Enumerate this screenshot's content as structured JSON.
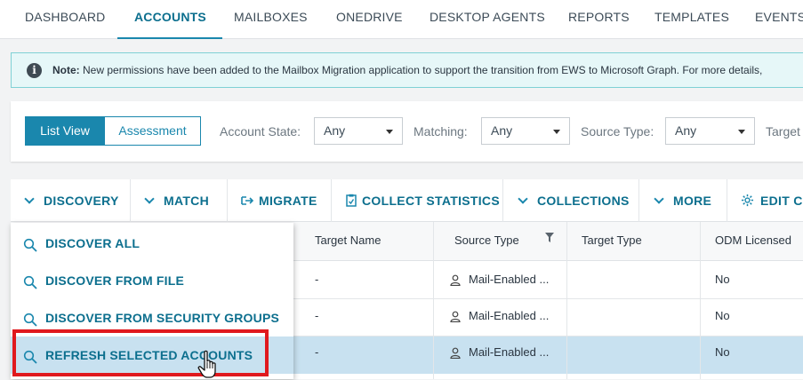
{
  "nav": {
    "tabs": [
      {
        "label": "DASHBOARD",
        "active": false
      },
      {
        "label": "ACCOUNTS",
        "active": true
      },
      {
        "label": "MAILBOXES",
        "active": false
      },
      {
        "label": "ONEDRIVE",
        "active": false
      },
      {
        "label": "DESKTOP AGENTS",
        "active": false
      },
      {
        "label": "REPORTS",
        "active": false
      },
      {
        "label": "TEMPLATES",
        "active": false
      },
      {
        "label": "EVENTS",
        "active": false
      }
    ]
  },
  "banner": {
    "icon": "info-icon",
    "note_label": "Note:",
    "text": " New permissions have been added to the Mailbox Migration application to support the transition from EWS to Microsoft Graph. For more details,"
  },
  "toolbar": {
    "view_toggle": {
      "list_view": "List View",
      "assessment": "Assessment",
      "selected": "List View"
    },
    "filters": [
      {
        "label": "Account State:",
        "value": "Any"
      },
      {
        "label": "Matching:",
        "value": "Any"
      },
      {
        "label": "Source Type:",
        "value": "Any"
      },
      {
        "label": "Target",
        "value": ""
      }
    ]
  },
  "actions": {
    "discovery": "DISCOVERY",
    "match": "MATCH",
    "migrate": "MIGRATE",
    "collect_statistics": "COLLECT STATISTICS",
    "collections": "COLLECTIONS",
    "more": "MORE",
    "edit_columns": "EDIT CO"
  },
  "dropdown": {
    "items": [
      {
        "label": "DISCOVER ALL",
        "icon": "search-icon"
      },
      {
        "label": "DISCOVER FROM FILE",
        "icon": "search-icon"
      },
      {
        "label": "DISCOVER FROM SECURITY GROUPS",
        "icon": "search-icon"
      },
      {
        "label": "REFRESH SELECTED ACCOUNTS",
        "icon": "search-icon",
        "highlighted": true
      }
    ]
  },
  "grid": {
    "columns": [
      "Target Name",
      "Source Type",
      "Target Type",
      "ODM Licensed"
    ],
    "rows": [
      {
        "target_name": "-",
        "source_type": "Mail-Enabled ...",
        "target_type": "",
        "odm_licensed": "No",
        "selected": false
      },
      {
        "target_name": "-",
        "source_type": "Mail-Enabled ...",
        "target_type": "",
        "odm_licensed": "No",
        "selected": false
      },
      {
        "target_name": "-",
        "source_type": "Mail-Enabled ...",
        "target_type": "",
        "odm_licensed": "No",
        "selected": true
      }
    ]
  },
  "colors": {
    "accent": "#1a87ad",
    "accent_dark": "#0c6f8e",
    "banner_bg": "#e6f7f8",
    "selected_row": "#c8e1f0",
    "highlight_box": "#e0191e"
  }
}
